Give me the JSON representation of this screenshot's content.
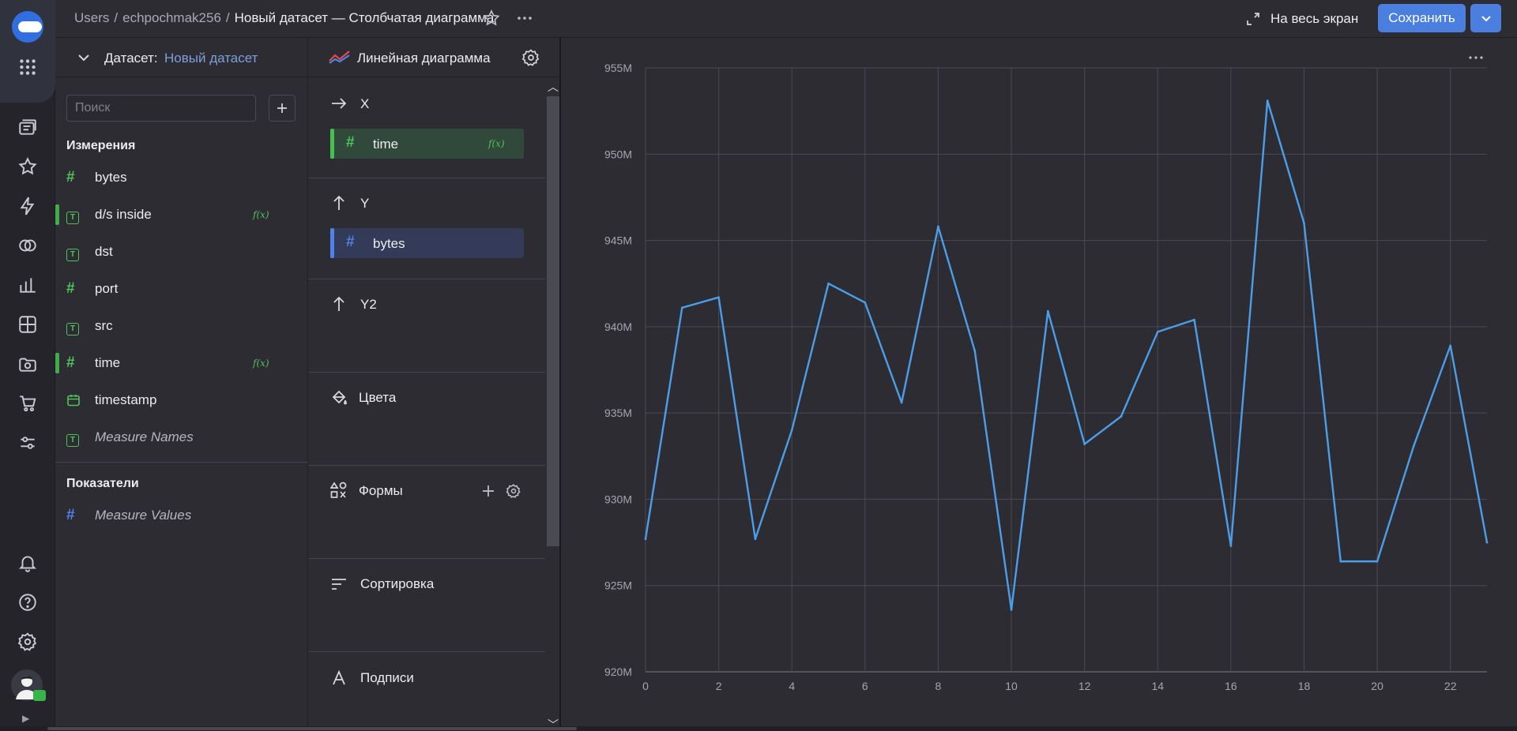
{
  "header": {
    "breadcrumbs": [
      "Users",
      "echpochmak256"
    ],
    "current": "Новый датасет — Столбчатая диаграмма",
    "fullscreen_label": "На весь экран",
    "save_label": "Сохранить"
  },
  "dataset": {
    "label": "Датасет:",
    "name": "Новый датасет",
    "search_placeholder": "Поиск",
    "dimensions_title": "Измерения",
    "dimensions": [
      {
        "name": "bytes",
        "type": "number",
        "formula": false
      },
      {
        "name": "d/s inside",
        "type": "text",
        "formula": true
      },
      {
        "name": "dst",
        "type": "text",
        "formula": false
      },
      {
        "name": "port",
        "type": "number",
        "formula": false
      },
      {
        "name": "src",
        "type": "text",
        "formula": false
      },
      {
        "name": "time",
        "type": "number",
        "formula": true
      },
      {
        "name": "timestamp",
        "type": "date",
        "formula": false
      },
      {
        "name": "Measure Names",
        "type": "text",
        "formula": false
      }
    ],
    "measures_title": "Показатели",
    "measures": [
      {
        "name": "Measure Values",
        "type": "number"
      }
    ],
    "formula_badge": "f(x)"
  },
  "wizard": {
    "visualization": "Линейная диаграмма",
    "sections": {
      "x": {
        "label": "X",
        "field": "time"
      },
      "y": {
        "label": "Y",
        "field": "bytes"
      },
      "y2": {
        "label": "Y2"
      },
      "colors": {
        "label": "Цвета"
      },
      "shapes": {
        "label": "Формы"
      },
      "sort": {
        "label": "Сортировка"
      },
      "labels": {
        "label": "Подписи"
      }
    }
  },
  "chart_data": {
    "type": "line",
    "title": "",
    "xlabel": "",
    "ylabel": "",
    "x": [
      0,
      1,
      2,
      3,
      4,
      5,
      6,
      7,
      8,
      9,
      10,
      11,
      12,
      13,
      14,
      15,
      16,
      17,
      18,
      19,
      20,
      21,
      22,
      23
    ],
    "series": [
      {
        "color": "#4a9eea",
        "values": [
          927.7,
          941.1,
          941.7,
          927.7,
          934.0,
          942.5,
          941.4,
          935.6,
          945.8,
          938.6,
          923.6,
          940.9,
          933.2,
          934.8,
          939.7,
          940.4,
          927.3,
          953.1,
          946.0,
          926.4,
          926.4,
          933.1,
          938.9,
          927.5
        ]
      }
    ],
    "x_ticks": [
      "0",
      "2",
      "4",
      "6",
      "8",
      "10",
      "12",
      "14",
      "16",
      "18",
      "20",
      "22"
    ],
    "y_ticks": [
      "920M",
      "925M",
      "930M",
      "935M",
      "940M",
      "945M",
      "950M",
      "955M"
    ],
    "ylim": [
      920,
      955
    ],
    "xlim": [
      0,
      23
    ],
    "grid": true,
    "legend": "none",
    "menu_icon": "more-icon"
  },
  "colors": {
    "accent": "#4a7fe0",
    "line": "#4a9eea",
    "dimension": "#4fc35a",
    "measure": "#4e82e6"
  }
}
